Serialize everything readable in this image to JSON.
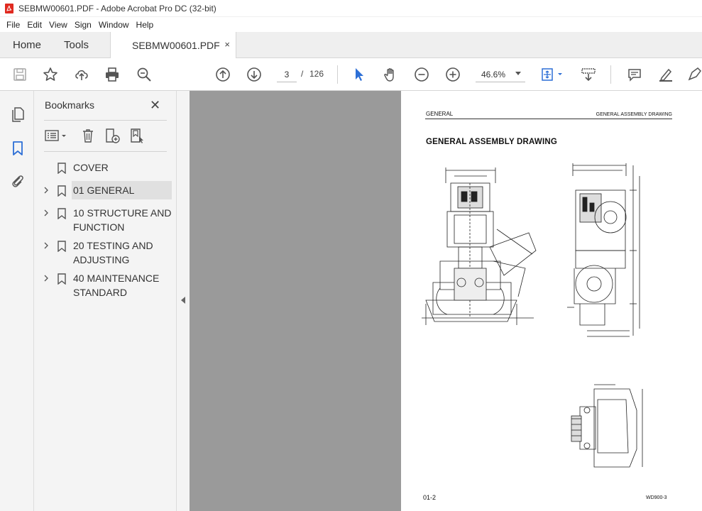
{
  "window": {
    "title": "SEBMW00601.PDF - Adobe Acrobat Pro DC (32-bit)"
  },
  "menu": {
    "items": [
      "File",
      "Edit",
      "View",
      "Sign",
      "Window",
      "Help"
    ]
  },
  "tabs": {
    "home": "Home",
    "tools": "Tools",
    "document": "SEBMW00601.PDF",
    "close_glyph": "×"
  },
  "toolbar": {
    "current_page": "3",
    "page_separator": "/",
    "total_pages": "126",
    "zoom": "46.6%",
    "icons": [
      "save-icon",
      "star-icon",
      "upload-icon",
      "print-icon",
      "find-icon",
      "previous-page-icon",
      "next-page-icon",
      "select-cursor-icon",
      "hand-icon",
      "zoom-out-icon",
      "zoom-in-icon",
      "fit-page-icon",
      "scrolling-mode-icon",
      "comment-icon",
      "highlight-icon",
      "draw-icon"
    ]
  },
  "bookmarks": {
    "title": "Bookmarks",
    "close_glyph": "✕",
    "items": [
      {
        "label": "COVER",
        "expandable": false,
        "selected": false
      },
      {
        "label": "01 GENERAL",
        "expandable": true,
        "selected": true
      },
      {
        "label": "10 STRUCTURE AND FUNCTION",
        "expandable": true,
        "selected": false
      },
      {
        "label": "20 TESTING AND ADJUSTING",
        "expandable": true,
        "selected": false
      },
      {
        "label": "40 MAINTENANCE STANDARD",
        "expandable": true,
        "selected": false
      }
    ]
  },
  "document_page": {
    "section": "GENERAL",
    "header_right": "GENERAL ASSEMBLY DRAWING",
    "heading": "GENERAL ASSEMBLY DRAWING",
    "footer_left": "01-2",
    "footer_right": "WD900-3"
  },
  "colors": {
    "accent_blue": "#2d6fd6",
    "icon_gray": "#555555",
    "pdf_red": "#e02a20",
    "doc_background": "#9a9a9a"
  }
}
